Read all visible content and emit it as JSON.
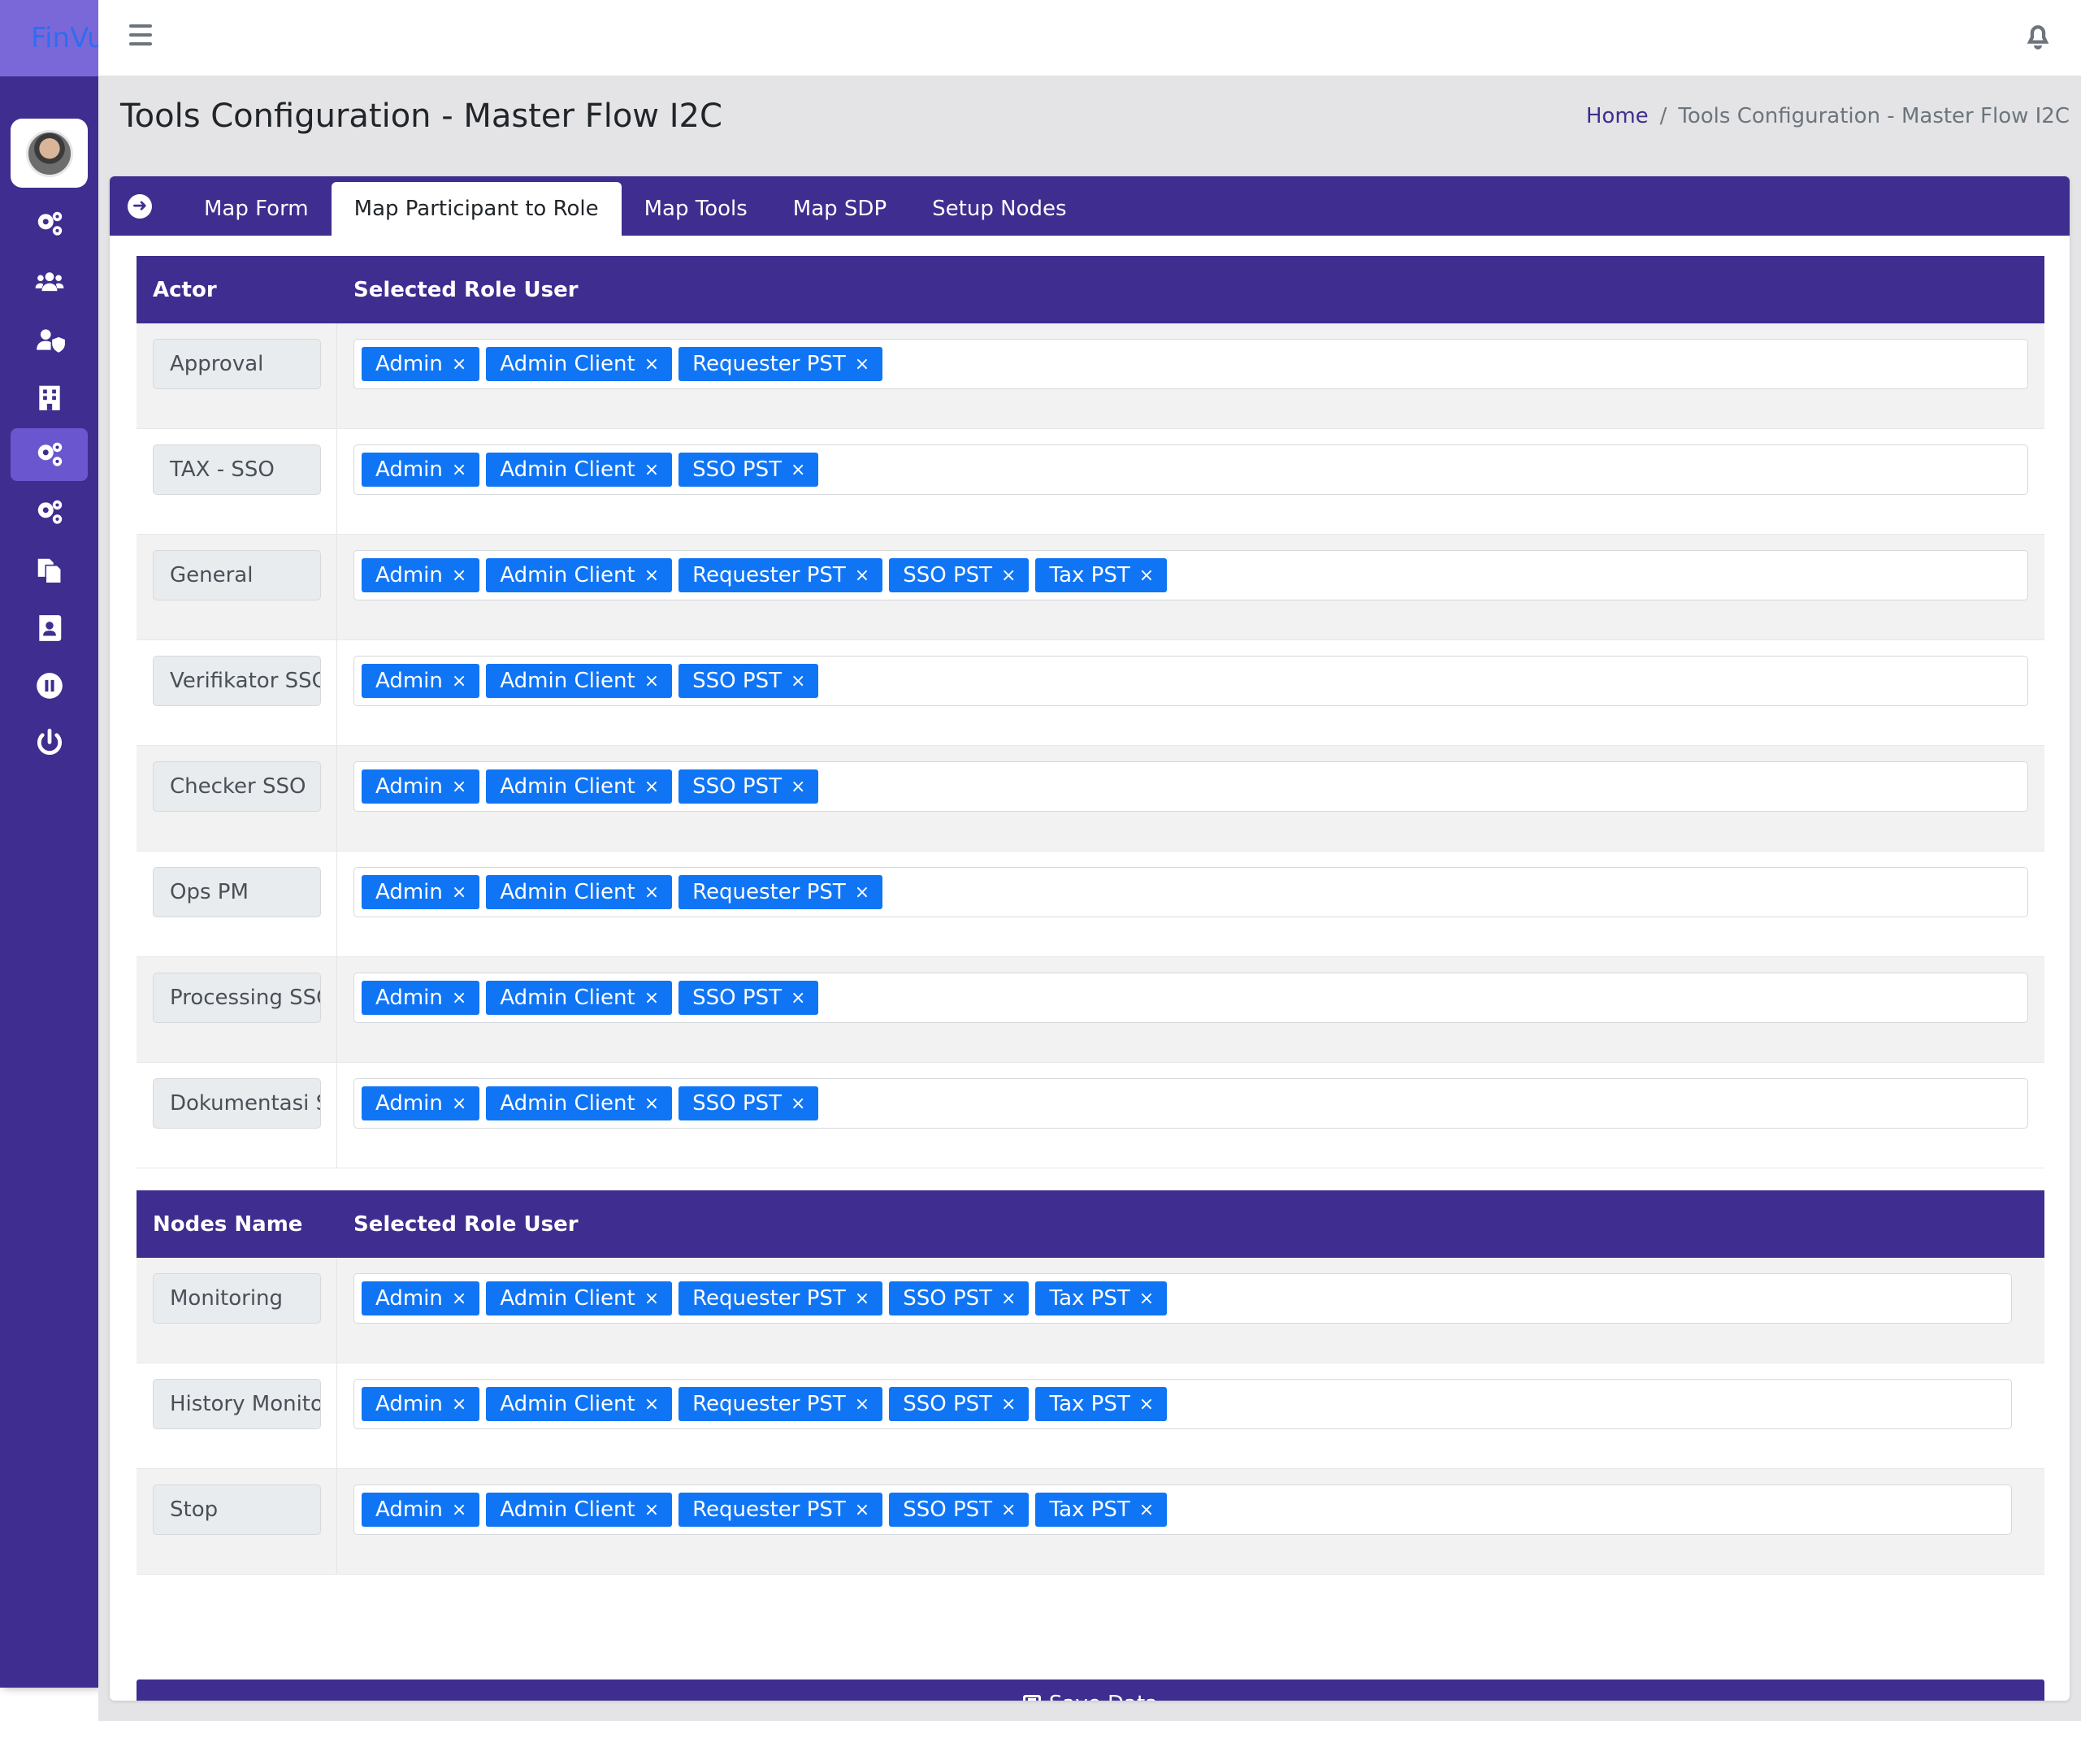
{
  "brand": "FinVu",
  "page_title": "Tools Configuration - Master Flow I2C",
  "breadcrumb": {
    "home": "Home",
    "separator": "/",
    "current": "Tools Configuration - Master Flow I2C"
  },
  "sidebar": {
    "items": [
      {
        "icon": "cogs-icon"
      },
      {
        "icon": "users-icon"
      },
      {
        "icon": "user-shield-icon"
      },
      {
        "icon": "building-icon"
      },
      {
        "icon": "cogs-icon",
        "active": true
      },
      {
        "icon": "cogs-icon"
      },
      {
        "icon": "copy-icon"
      },
      {
        "icon": "address-book-icon"
      },
      {
        "icon": "pause-circle-icon"
      },
      {
        "icon": "power-icon"
      }
    ]
  },
  "tabs": [
    {
      "label": "Map Form"
    },
    {
      "label": "Map Participant to Role",
      "active": true
    },
    {
      "label": "Map Tools"
    },
    {
      "label": "Map SDP"
    },
    {
      "label": "Setup Nodes"
    }
  ],
  "actors_table": {
    "col1": "Actor",
    "col2": "Selected Role User",
    "rows": [
      {
        "actor": "Approval",
        "roles": [
          "Admin",
          "Admin Client",
          "Requester PST"
        ]
      },
      {
        "actor": "TAX - SSO",
        "roles": [
          "Admin",
          "Admin Client",
          "SSO PST"
        ]
      },
      {
        "actor": "General",
        "roles": [
          "Admin",
          "Admin Client",
          "Requester PST",
          "SSO PST",
          "Tax PST"
        ]
      },
      {
        "actor": "Verifikator SSC",
        "roles": [
          "Admin",
          "Admin Client",
          "SSO PST"
        ]
      },
      {
        "actor": "Checker SSO",
        "roles": [
          "Admin",
          "Admin Client",
          "SSO PST"
        ]
      },
      {
        "actor": "Ops PM",
        "roles": [
          "Admin",
          "Admin Client",
          "Requester PST"
        ]
      },
      {
        "actor": "Processing SSC",
        "roles": [
          "Admin",
          "Admin Client",
          "SSO PST"
        ]
      },
      {
        "actor": "Dokumentasi SSO",
        "roles": [
          "Admin",
          "Admin Client",
          "SSO PST"
        ]
      }
    ]
  },
  "nodes_table": {
    "col1": "Nodes Name",
    "col2": "Selected Role User",
    "rows": [
      {
        "actor": "Monitoring",
        "roles": [
          "Admin",
          "Admin Client",
          "Requester PST",
          "SSO PST",
          "Tax PST"
        ]
      },
      {
        "actor": "History Monitoring",
        "roles": [
          "Admin",
          "Admin Client",
          "Requester PST",
          "SSO PST",
          "Tax PST"
        ]
      },
      {
        "actor": "Stop",
        "roles": [
          "Admin",
          "Admin Client",
          "Requester PST",
          "SSO PST",
          "Tax PST"
        ]
      }
    ]
  },
  "tag_remove_symbol": "×",
  "save_button": "Save Data",
  "colors": {
    "primary": "#3f2d8f",
    "tag": "#1075f5",
    "brand_bg": "#7a68d8"
  }
}
